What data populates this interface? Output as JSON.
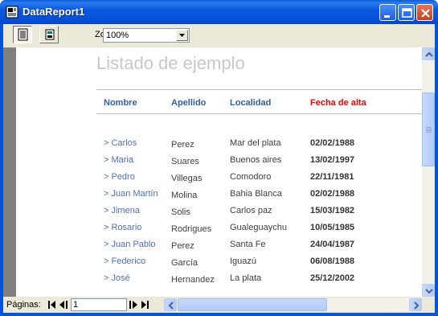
{
  "window": {
    "title": "DataReport1"
  },
  "toolbar": {
    "zoom_label": "Zoom",
    "zoom_value": "100%"
  },
  "report": {
    "title": "Listado de ejemplo",
    "headers": {
      "nombre": "Nombre",
      "apellido": "Apellido",
      "localidad": "Localidad",
      "fecha": "Fecha de alta"
    },
    "header_colors": {
      "normal": "#2f5fa9",
      "highlight": "#ff0000"
    },
    "rows": [
      {
        "nombre": "> Carlos",
        "apellido": "Perez",
        "localidad": "Mar del plata",
        "fecha": "02/02/1988"
      },
      {
        "nombre": "> Maria",
        "apellido": "Suares",
        "localidad": "Buenos aires",
        "fecha": "13/02/1997"
      },
      {
        "nombre": "> Pedro",
        "apellido": "Villegas",
        "localidad": "Comodoro",
        "fecha": "22/11/1981"
      },
      {
        "nombre": "> Juan Martín",
        "apellido": "Molina",
        "localidad": "Bahia Blanca",
        "fecha": "02/02/1988"
      },
      {
        "nombre": "> Jimena",
        "apellido": "Solis",
        "localidad": "Carlos paz",
        "fecha": "15/03/1982"
      },
      {
        "nombre": "> Rosario",
        "apellido": "Rodrigues",
        "localidad": "Gualeguaychu",
        "fecha": "10/05/1985"
      },
      {
        "nombre": "> Juan Pablo",
        "apellido": "Perez",
        "localidad": "Santa Fe",
        "fecha": "24/04/1987"
      },
      {
        "nombre": "> Federico",
        "apellido": "García",
        "localidad": "Iguazú",
        "fecha": "06/08/1988"
      },
      {
        "nombre": "> José",
        "apellido": "Hernandez",
        "localidad": "La plata",
        "fecha": "25/12/2002"
      }
    ]
  },
  "statusbar": {
    "pages_label": "Páginas:",
    "page_value": "1"
  },
  "icons": {
    "app": "report-app-icon",
    "minimize": "minimize-icon",
    "maximize": "maximize-icon",
    "close": "close-icon",
    "print": "print-icon",
    "export": "export-icon"
  }
}
